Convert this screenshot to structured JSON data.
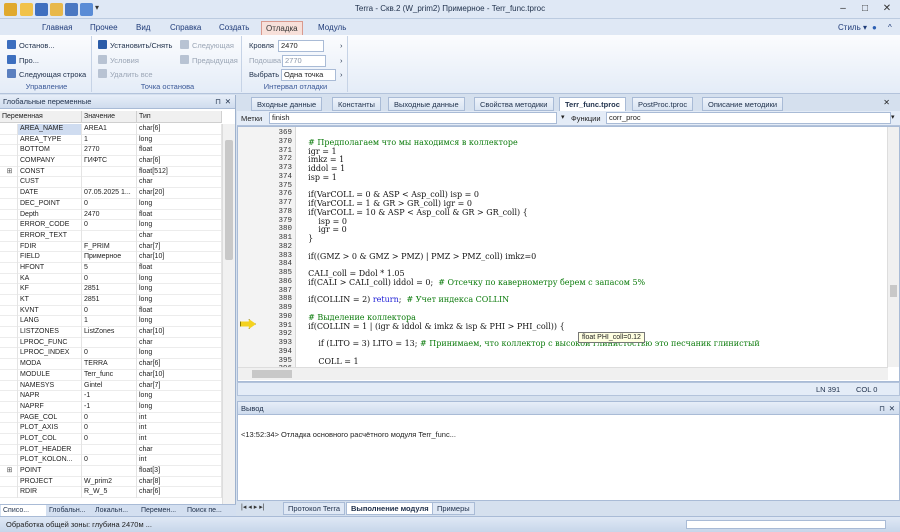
{
  "window": {
    "title": "Terra - Скв.2 (W_prim2) Примерное - Terr_func.tproc",
    "style_label": "Стиль"
  },
  "ribbon_tabs": [
    "Главная",
    "Прочее",
    "Вид",
    "Справка",
    "Создать",
    "Отладка",
    "Модуль"
  ],
  "ribbon": {
    "control": {
      "label": "Управление",
      "stop": "Останов...",
      "go": "Про...",
      "next_line": "Следующая строка"
    },
    "breakpoint": {
      "label": "Точка останова",
      "set": "Установить/Снять",
      "next": "Следующая",
      "conditions": "Условия",
      "prev": "Предыдущая",
      "remove_all": "Удалить все"
    },
    "interval": {
      "label": "Интервал отладки",
      "roof_label": "Кровля",
      "roof_value": "2470",
      "floor_label": "Подошва",
      "floor_value": "2770",
      "choose_label": "Выбрать",
      "choose_value": "Одна точка"
    }
  },
  "left_panel": {
    "title": "Глобальные переменные",
    "columns": [
      "Переменная",
      "Значение",
      "Тип"
    ],
    "rows": [
      {
        "e": "",
        "n": "AREA_NAME",
        "v": "AREA1",
        "t": "char[6]"
      },
      {
        "e": "",
        "n": "AREA_TYPE",
        "v": "1",
        "t": "long"
      },
      {
        "e": "",
        "n": "BOTTOM",
        "v": "2770",
        "t": "float"
      },
      {
        "e": "",
        "n": "COMPANY",
        "v": "ГИФТС",
        "t": "char[6]"
      },
      {
        "e": "⊞",
        "n": "CONST",
        "v": "",
        "t": "float[512]"
      },
      {
        "e": "",
        "n": "CUST",
        "v": "",
        "t": "char"
      },
      {
        "e": "",
        "n": "DATE",
        "v": "07.05.2025 1...",
        "t": "char[20]"
      },
      {
        "e": "",
        "n": "DEC_POINT",
        "v": "0",
        "t": "long"
      },
      {
        "e": "",
        "n": "Depth",
        "v": "2470",
        "t": "float"
      },
      {
        "e": "",
        "n": "ERROR_CODE",
        "v": "0",
        "t": "long"
      },
      {
        "e": "",
        "n": "ERROR_TEXT",
        "v": "",
        "t": "char"
      },
      {
        "e": "",
        "n": "FDIR",
        "v": "F_PRIM",
        "t": "char[7]"
      },
      {
        "e": "",
        "n": "FIELD",
        "v": "Примерное",
        "t": "char[10]"
      },
      {
        "e": "",
        "n": "HFONT",
        "v": "5",
        "t": "float"
      },
      {
        "e": "",
        "n": "KA",
        "v": "0",
        "t": "long"
      },
      {
        "e": "",
        "n": "KF",
        "v": "2851",
        "t": "long"
      },
      {
        "e": "",
        "n": "KT",
        "v": "2851",
        "t": "long"
      },
      {
        "e": "",
        "n": "KVNT",
        "v": "0",
        "t": "float"
      },
      {
        "e": "",
        "n": "LANG",
        "v": "1",
        "t": "long"
      },
      {
        "e": "",
        "n": "LISTZONES",
        "v": "ListZones",
        "t": "char[10]"
      },
      {
        "e": "",
        "n": "LPROC_FUNC",
        "v": "",
        "t": "char"
      },
      {
        "e": "",
        "n": "LPROC_INDEX",
        "v": "0",
        "t": "long"
      },
      {
        "e": "",
        "n": "MODA",
        "v": "TERRA",
        "t": "char[6]"
      },
      {
        "e": "",
        "n": "MODULE",
        "v": "Terr_func",
        "t": "char[10]"
      },
      {
        "e": "",
        "n": "NAMESYS",
        "v": "Gintel",
        "t": "char[7]"
      },
      {
        "e": "",
        "n": "NAPR",
        "v": "-1",
        "t": "long"
      },
      {
        "e": "",
        "n": "NAPRF",
        "v": "-1",
        "t": "long"
      },
      {
        "e": "",
        "n": "PAGE_COL",
        "v": "0",
        "t": "int"
      },
      {
        "e": "",
        "n": "PLOT_AXIS",
        "v": "0",
        "t": "int"
      },
      {
        "e": "",
        "n": "PLOT_COL",
        "v": "0",
        "t": "int"
      },
      {
        "e": "",
        "n": "PLOT_HEADER",
        "v": "",
        "t": "char"
      },
      {
        "e": "",
        "n": "PLOT_KOLON...",
        "v": "0",
        "t": "int"
      },
      {
        "e": "⊞",
        "n": "POINT",
        "v": "",
        "t": "float[3]"
      },
      {
        "e": "",
        "n": "PROJECT",
        "v": "W_prim2",
        "t": "char[8]"
      },
      {
        "e": "",
        "n": "RDIR",
        "v": "R_W_5",
        "t": "char[6]"
      }
    ],
    "tabs": [
      "Списо...",
      "Глобальн...",
      "Локальн...",
      "Перемен...",
      "Поиск пе..."
    ]
  },
  "doc_tabs": [
    "Входные данные",
    "Константы",
    "Выходные данные",
    "Свойства методики",
    "Terr_func.tproc",
    "PostProc.tproc",
    "Описание методики"
  ],
  "selector": {
    "marks_label": "Метки",
    "marks_value": "finish",
    "funcs_label": "Функции",
    "funcs_value": "corr_proc"
  },
  "editor": {
    "line_numbers": [
      "369",
      "370",
      "371",
      "372",
      "373",
      "374",
      "375",
      "376",
      "377",
      "378",
      "379",
      "380",
      "381",
      "382",
      "383",
      "384",
      "385",
      "386",
      "387",
      "388",
      "389",
      "390",
      "391",
      "392",
      "393",
      "394",
      "395",
      "396"
    ],
    "lines": [
      [],
      [
        {
          "c": "cm",
          "t": "    # Предполагаем что мы находимся в коллекторе"
        }
      ],
      [
        {
          "c": "",
          "t": "    igr = 1"
        }
      ],
      [
        {
          "c": "",
          "t": "    imkz = 1"
        }
      ],
      [
        {
          "c": "",
          "t": "    iddol = 1"
        }
      ],
      [
        {
          "c": "",
          "t": "    isp = 1"
        }
      ],
      [],
      [
        {
          "c": "",
          "t": "    if(VarCOLL = 0 & ASP < Asp_coll) isp = 0"
        }
      ],
      [
        {
          "c": "",
          "t": "    if(VarCOLL = 1 & GR > GR_coll) igr = 0"
        }
      ],
      [
        {
          "c": "",
          "t": "    if(VarCOLL = 10 & ASP < Asp_coll & GR > GR_coll) {"
        }
      ],
      [
        {
          "c": "",
          "t": "        isp = 0"
        }
      ],
      [
        {
          "c": "",
          "t": "        igr = 0"
        }
      ],
      [
        {
          "c": "",
          "t": "    }"
        }
      ],
      [],
      [
        {
          "c": "",
          "t": "    if((GMZ > 0 & GMZ > PMZ) | PMZ > PMZ_coll) imkz=0"
        }
      ],
      [],
      [
        {
          "c": "",
          "t": "    CALI_coll = Ddol * 1.05"
        }
      ],
      [
        {
          "c": "",
          "t": "    if(CALI > CALI_coll) iddol = 0;  "
        },
        {
          "c": "cm",
          "t": "# Отсечку по кавернометру берем с запасом 5%"
        }
      ],
      [],
      [
        {
          "c": "",
          "t": "    if(COLLIN = 2) "
        },
        {
          "c": "kw",
          "t": "return"
        },
        {
          "c": "",
          "t": ";  "
        },
        {
          "c": "cm",
          "t": "# Учет индекса COLLIN"
        }
      ],
      [],
      [
        {
          "c": "cm",
          "t": "    # Выделение коллектора"
        }
      ],
      [
        {
          "c": "",
          "t": "    if(COLLIN = 1 | (igr & iddol & imkz & isp & PHI > PHI_coll)) {"
        }
      ],
      [],
      [
        {
          "c": "",
          "t": "        if (LITO = 3) LITO = 13; "
        },
        {
          "c": "cm",
          "t": "# Принимаем, что коллектор с высокой глинистостью это песчаник глинистый"
        }
      ],
      [],
      [
        {
          "c": "",
          "t": "        COLL = 1"
        }
      ],
      []
    ],
    "tooltip": "float PHI_coll=0.12",
    "status_ln": "LN 391",
    "status_col": "COL 0"
  },
  "output": {
    "title": "Вывод",
    "message": "<13:52:34> Отладка основного расчётного модуля Terr_func..."
  },
  "bottom_tabs": [
    "Протокол Terra",
    "Выполнение модуля",
    "Примеры"
  ],
  "statusbar": {
    "text": "Обработка общей зоны: глубина 2470м ..."
  }
}
